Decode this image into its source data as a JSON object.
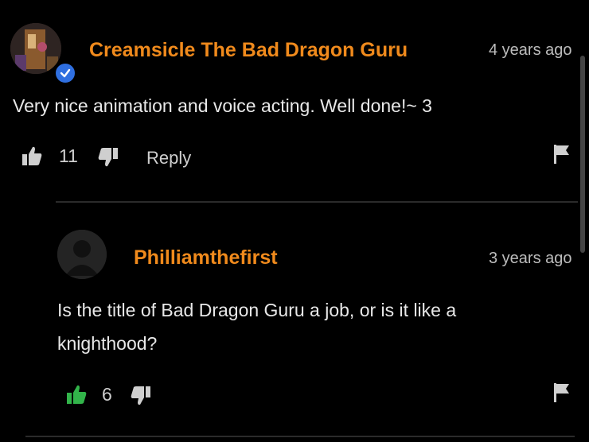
{
  "comment": {
    "author": "Creamsicle The Bad Dragon Guru",
    "time": "4 years ago",
    "text": "Very nice animation and voice acting. Well done!~ 3",
    "likes": "11",
    "reply_label": "Reply",
    "icons": {
      "like": "thumbs-up-icon",
      "dislike": "thumbs-down-icon",
      "flag": "flag-icon",
      "verified": "verified-check-icon"
    }
  },
  "reply": {
    "author": "Philliamthefirst",
    "time": "3 years ago",
    "text_line1": "Is the title of Bad Dragon Guru a job, or is it like a",
    "text_line2": "knighthood?",
    "likes": "6",
    "liked": true,
    "colors": {
      "accent": "#f08a1c",
      "liked": "#32b44a"
    }
  }
}
